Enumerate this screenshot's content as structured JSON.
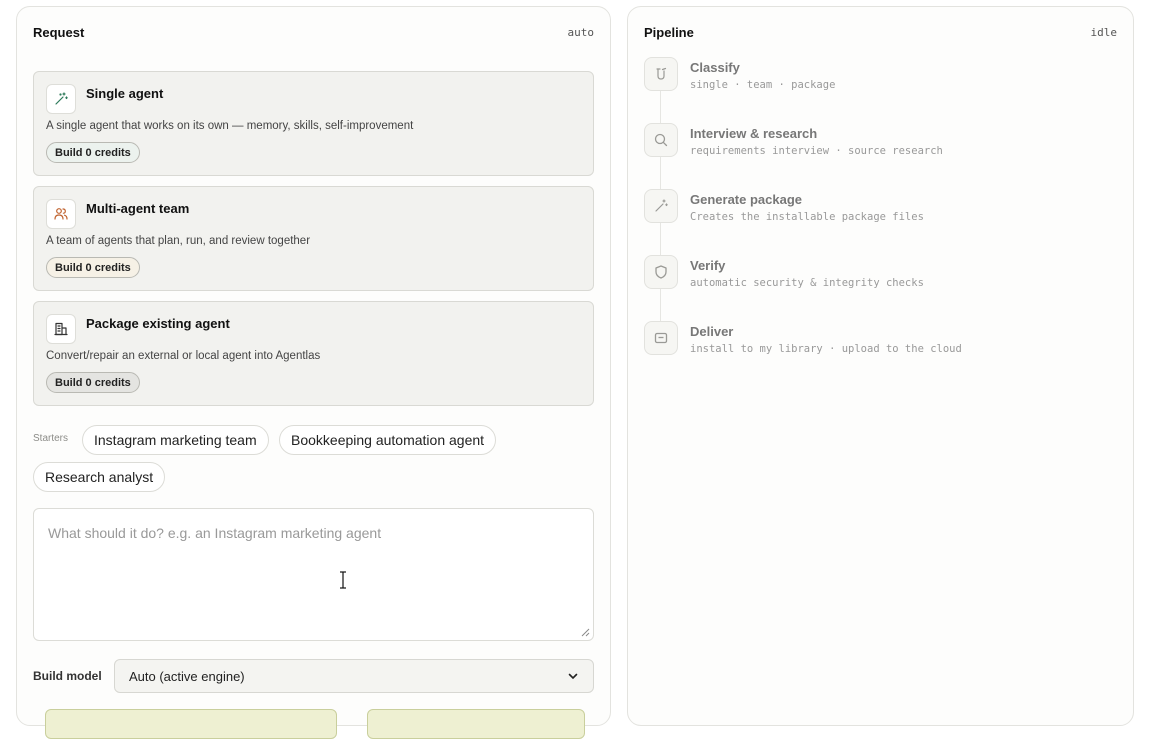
{
  "request": {
    "title": "Request",
    "status": "auto",
    "cards": [
      {
        "title": "Single agent",
        "description": "A single agent that works on its own — memory, skills, self-improvement",
        "badge": "Build 0 credits",
        "icon": "magic-wand-icon"
      },
      {
        "title": "Multi-agent team",
        "description": "A team of agents that plan, run, and review together",
        "badge": "Build 0 credits",
        "icon": "users-icon"
      },
      {
        "title": "Package existing agent",
        "description": "Convert/repair an external or local agent into Agentlas",
        "badge": "Build 0 credits",
        "icon": "building-package-icon"
      }
    ],
    "starters": {
      "label": "Starters",
      "items": [
        "Instagram marketing team",
        "Bookkeeping automation agent",
        "Research analyst"
      ]
    },
    "prompt": {
      "placeholder": "What should it do? e.g. an Instagram marketing agent",
      "value": ""
    },
    "build_model": {
      "label": "Build model",
      "selected": "Auto (active engine)"
    }
  },
  "pipeline": {
    "title": "Pipeline",
    "status": "idle",
    "steps": [
      {
        "name": "Classify",
        "description": "single · team · package",
        "icon": "classify-icon"
      },
      {
        "name": "Interview & research",
        "description": "requirements interview · source research",
        "icon": "search-icon"
      },
      {
        "name": "Generate package",
        "description": "Creates the installable package files",
        "icon": "magic-wand-icon"
      },
      {
        "name": "Verify",
        "description": "automatic security & integrity checks",
        "icon": "shield-icon"
      },
      {
        "name": "Deliver",
        "description": "install to my library · upload to the cloud",
        "icon": "inbox-icon"
      }
    ]
  },
  "colors": {
    "accent_green": "#3a7a5a",
    "accent_orange": "#c0622e",
    "card_bg": "#f2f2ef"
  }
}
